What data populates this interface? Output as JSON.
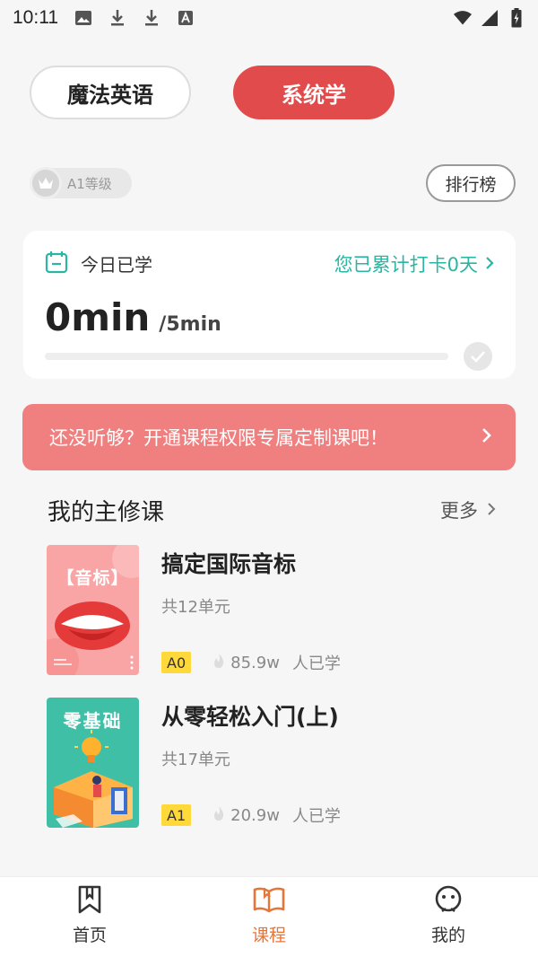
{
  "status_bar": {
    "time": "10:11"
  },
  "mode_toggle": {
    "left_label": "魔法英语",
    "right_label": "系统学"
  },
  "level": {
    "label": "A1等级"
  },
  "rank_button": {
    "label": "排行榜"
  },
  "today_card": {
    "label": "今日已学",
    "streak_text": "您已累计打卡0天",
    "minutes": "0min",
    "goal": "/5min",
    "progress": 0
  },
  "promo": {
    "text": "还没听够？开通课程权限专属定制课吧！"
  },
  "section": {
    "title": "我的主修课",
    "more_label": "更多"
  },
  "courses": [
    {
      "cover_text": "【音标】",
      "title": "搞定国际音标",
      "units": "共12单元",
      "level": "A0",
      "learners": "85.9w",
      "learners_suffix": "人已学"
    },
    {
      "cover_text": "零基础",
      "title": "从零轻松入门(上)",
      "units": "共17单元",
      "level": "A1",
      "learners": "20.9w",
      "learners_suffix": "人已学"
    }
  ],
  "bottom_nav": [
    {
      "label": "首页",
      "icon": "bookmark-icon"
    },
    {
      "label": "课程",
      "icon": "open-book-icon",
      "active": true
    },
    {
      "label": "我的",
      "icon": "smiley-icon"
    }
  ],
  "colors": {
    "accent_red": "#e14b4b",
    "promo_red": "#f07f7f",
    "teal": "#2bb5a3",
    "nav_active": "#e87538"
  }
}
